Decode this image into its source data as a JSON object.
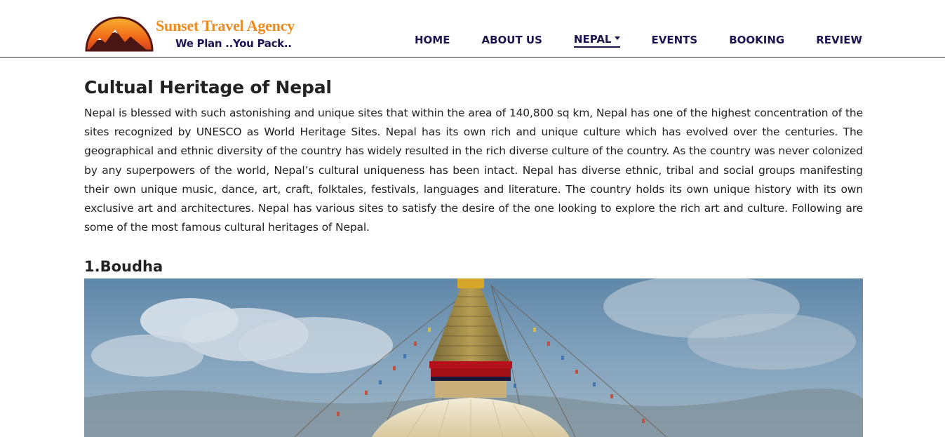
{
  "brand": {
    "name": "Sunset Travel Agency",
    "tagline": "We Plan ..You Pack.."
  },
  "nav": {
    "items": [
      {
        "label": "HOME"
      },
      {
        "label": "ABOUT US"
      },
      {
        "label": "NEPAL"
      },
      {
        "label": "EVENTS"
      },
      {
        "label": "BOOKING"
      },
      {
        "label": "REVIEW"
      }
    ],
    "active_item": "NEPAL"
  },
  "main": {
    "title": "Cultual Heritage of Nepal",
    "intro": "Nepal is blessed with such astonishing and unique sites that within the area of 140,800 sq km, Nepal has one of the highest concentration of the sites recognized by UNESCO as World Heritage Sites. Nepal has its own rich and unique culture which has evolved over the centuries. The geographical and ethnic diversity of the country has widely resulted in the rich diverse culture of the country. As the country was never colonized by any superpowers of the world, Nepal’s cultural uniqueness has been intact. Nepal has diverse ethnic, tribal and social groups manifesting their own unique music, dance, art, craft, folktales, festivals, languages and literature. The country holds its own unique history with its own exclusive art and architectures. Nepal has various sites to satisfy the desire of the one looking to explore the rich art and culture. Following are some of the most famous cultural heritages of Nepal.",
    "sections": [
      {
        "title": "1.Boudha",
        "image": "boudha-stupa-photo"
      }
    ]
  },
  "colors": {
    "nav_text": "#1e1450",
    "brand_orange": "#f08a1c",
    "text": "#222222"
  }
}
